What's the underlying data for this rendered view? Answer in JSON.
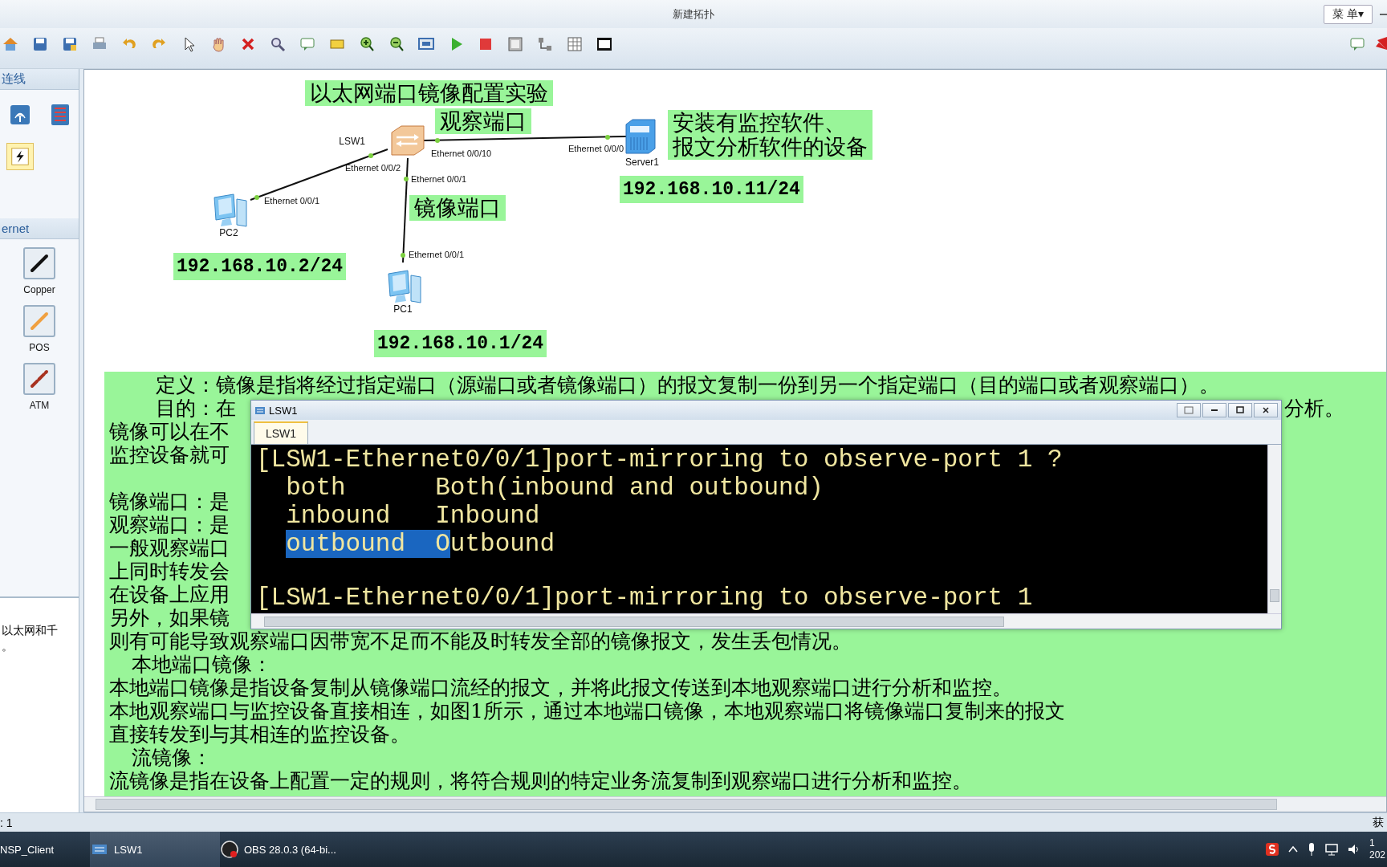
{
  "window": {
    "title": "新建拓扑",
    "menu_button": "菜 单▾"
  },
  "left_panel": {
    "connection_header": "连线",
    "tools": [
      {
        "selected": false
      },
      {
        "selected": false
      },
      {
        "selected": true
      }
    ],
    "cable_header": "ernet",
    "cables": [
      {
        "label": "Copper",
        "color": "#111111"
      },
      {
        "label": "POS",
        "color": "#f0a040"
      },
      {
        "label": "ATM",
        "color": "#a83220"
      }
    ],
    "description": [
      "以太网和千",
      "。"
    ]
  },
  "topology": {
    "nodes": [
      {
        "name": "LSW1",
        "kind": "switch"
      },
      {
        "name": "Server1",
        "kind": "server"
      },
      {
        "name": "PC2",
        "kind": "pc"
      },
      {
        "name": "PC1",
        "kind": "pc"
      }
    ],
    "port_labels": [
      "Ethernet 0/0/2",
      "Ethernet 0/0/10",
      "Ethernet 0/0/1",
      "Ethernet 0/0/0",
      "Ethernet 0/0/1",
      "Ethernet 0/0/1"
    ],
    "notes": [
      {
        "kind": "caption",
        "lines": [
          "以太网端口镜像配置实验"
        ]
      },
      {
        "kind": "caption",
        "lines": [
          "观察端口"
        ]
      },
      {
        "kind": "caption",
        "lines": [
          "安装有监控软件、",
          "报文分析软件的设备"
        ]
      },
      {
        "kind": "address",
        "lines": [
          "192.168.10.11/24"
        ]
      },
      {
        "kind": "caption",
        "lines": [
          "镜像端口"
        ]
      },
      {
        "kind": "address",
        "lines": [
          "192.168.10.2/24"
        ]
      },
      {
        "kind": "address",
        "lines": [
          "192.168.10.1/24"
        ]
      }
    ]
  },
  "text_blocks": [
    {
      "lines": [
        {
          "kind": "indent2",
          "text": "定义：镜像是指将经过指定端口（源端口或者镜像端口）的报文复制一份到另一个指定端口（目的端口或者观察端口）。"
        },
        {
          "kind": "indent2",
          "text": "目的：在",
          "tail": "分析。"
        },
        {
          "kind": "plain",
          "text": "镜像可以在不"
        },
        {
          "kind": "plain",
          "text": "监控设备就可"
        }
      ]
    },
    {
      "lines": [
        {
          "kind": "plain",
          "text": "镜像端口：是"
        },
        {
          "kind": "plain",
          "text": "观察端口：是"
        },
        {
          "kind": "plain",
          "text": "一般观察端口"
        },
        {
          "kind": "plain",
          "text": "上同时转发会"
        },
        {
          "kind": "plain",
          "text": "在设备上应用"
        },
        {
          "kind": "plain",
          "text": "另外，如果镜"
        },
        {
          "kind": "plain",
          "text": "则有可能导致观察端口因带宽不足而不能及时转发全部的镜像报文，发生丢包情况。"
        },
        {
          "kind": "indent1",
          "text": "本地端口镜像："
        },
        {
          "kind": "plain",
          "text": "本地端口镜像是指设备复制从镜像端口流经的报文，并将此报文传送到本地观察端口进行分析和监控。"
        },
        {
          "kind": "plain",
          "text": "本地观察端口与监控设备直接相连，如图1所示，通过本地端口镜像，本地观察端口将镜像端口复制来的报文"
        },
        {
          "kind": "plain",
          "text": "直接转发到与其相连的监控设备。"
        },
        {
          "kind": "indent1",
          "text": "流镜像："
        },
        {
          "kind": "plain",
          "text": "流镜像是指在设备上配置一定的规则，将符合规则的特定业务流复制到观察端口进行分析和监控。"
        }
      ]
    }
  ],
  "terminal": {
    "title": "LSW1",
    "tabs": [
      {
        "label": "LSW1",
        "selected": true
      }
    ],
    "lines": [
      {
        "kind": "command",
        "segments": [
          {
            "text": "[LSW1-Ethernet0/0/1]port-mirroring to observe-port 1 ?",
            "selected": false
          }
        ]
      },
      {
        "kind": "option",
        "segments": [
          {
            "text": "both      Both(inbound and outbound)",
            "selected": false
          }
        ]
      },
      {
        "kind": "option",
        "segments": [
          {
            "text": "inbound   Inbound",
            "selected": false
          }
        ]
      },
      {
        "kind": "option",
        "segments": [
          {
            "text": "outbound  O",
            "selected": true
          },
          {
            "text": "utbound",
            "selected": false
          }
        ]
      }
    ],
    "prompt": "[LSW1-Ethernet0/0/1]port-mirroring to observe-port 1"
  },
  "status_bar": {
    "left": ": 1",
    "right": "获"
  },
  "taskbar": {
    "items": [
      {
        "label": "NSP_Client",
        "selected": false
      },
      {
        "label": "LSW1",
        "selected": true
      },
      {
        "label": "OBS 28.0.3 (64-bi...",
        "selected": false
      }
    ],
    "clock": {
      "time": "1",
      "date": "202"
    }
  }
}
